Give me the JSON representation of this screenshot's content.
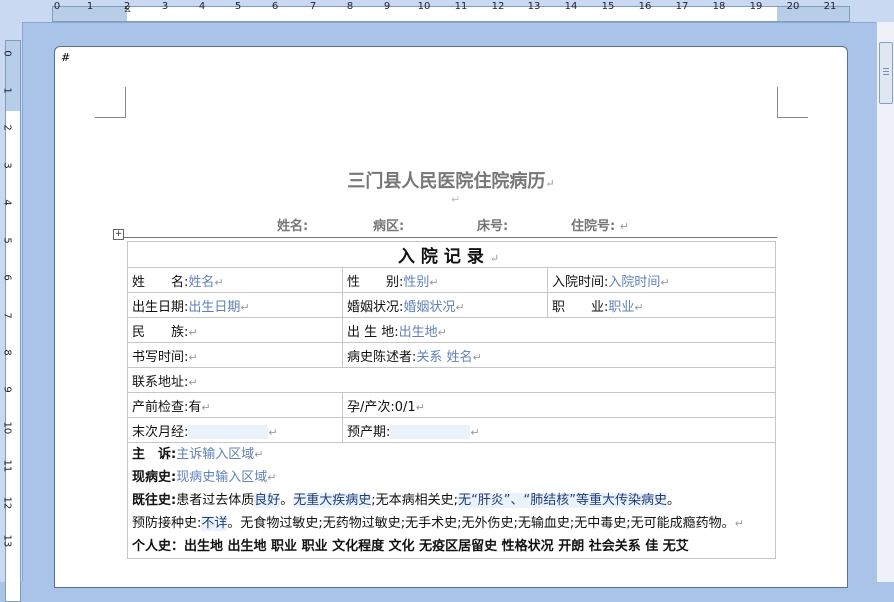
{
  "ruler": {
    "h_numbers": [
      "0",
      "1",
      "2",
      "3",
      "4",
      "5",
      "6",
      "7",
      "8",
      "9",
      "10",
      "11",
      "12",
      "13",
      "14",
      "15",
      "16",
      "17",
      "18",
      "19",
      "20",
      "21"
    ],
    "v_numbers": [
      "0",
      "1",
      "2",
      "3",
      "4",
      "5",
      "6",
      "7",
      "8",
      "9",
      "10",
      "11",
      "12",
      "13"
    ]
  },
  "doc": {
    "hash": "#",
    "title": "三门县人民医院住院病历",
    "patient_labels": [
      "姓名:",
      "病区:",
      "床号:",
      "住院号:"
    ],
    "record_title": "入院记录",
    "rows": {
      "name_label": "姓　　名:",
      "name_value": "姓名",
      "sex_label": "性　　别:",
      "sex_value": "性别",
      "admit_label": "入院时间:",
      "admit_value": "入院时间",
      "birth_label": "出生日期:",
      "birth_value": "出生日期",
      "marital_label": "婚姻状况:",
      "marital_value": "婚姻状况",
      "job_label": "职　　业:",
      "job_value": "职业",
      "ethnic_label": "民　　族:",
      "birthplace_label": "出 生 地:",
      "birthplace_value": "出生地",
      "write_label": "书写时间:",
      "narrator_label": "病史陈述者:",
      "narrator_value": "关系 姓名",
      "address_label": "联系地址:",
      "prenatal_label": "产前检查:",
      "prenatal_value": "有",
      "gp_label": "孕/产次:",
      "gp_value": "0/1",
      "lmp_label": "末次月经:",
      "edc_label": "预产期:",
      "cc_label": "主　诉:",
      "cc_value": "主诉输入区域",
      "hpi_label": "现病史:",
      "hpi_value": "现病史输入区域",
      "pmh_label": "既往史:",
      "pmh_text1": "患者过去体质",
      "pmh_good": "良好",
      "pmh_text2": "。",
      "pmh_none1": "无重大疾病史",
      "pmh_semi": ";",
      "pmh_none2": "无本病相关史",
      "pmh_none3": "无“肝炎”、“肺结核”等重大传染病史",
      "pmh_end": "。",
      "vacc_label": "预防接种史:",
      "vacc_value": "不详",
      "vacc_rest": "。无食物过敏史;无药物过敏史;无手术史;无外伤史;无输血史;无中毒史;无可能成瘾药物。",
      "last_row": "个人史：出生地 出生地 职业 职业 文化程度 文化 无疫区居留史 性格状况 开朗 社会关系 佳 无艾"
    }
  }
}
